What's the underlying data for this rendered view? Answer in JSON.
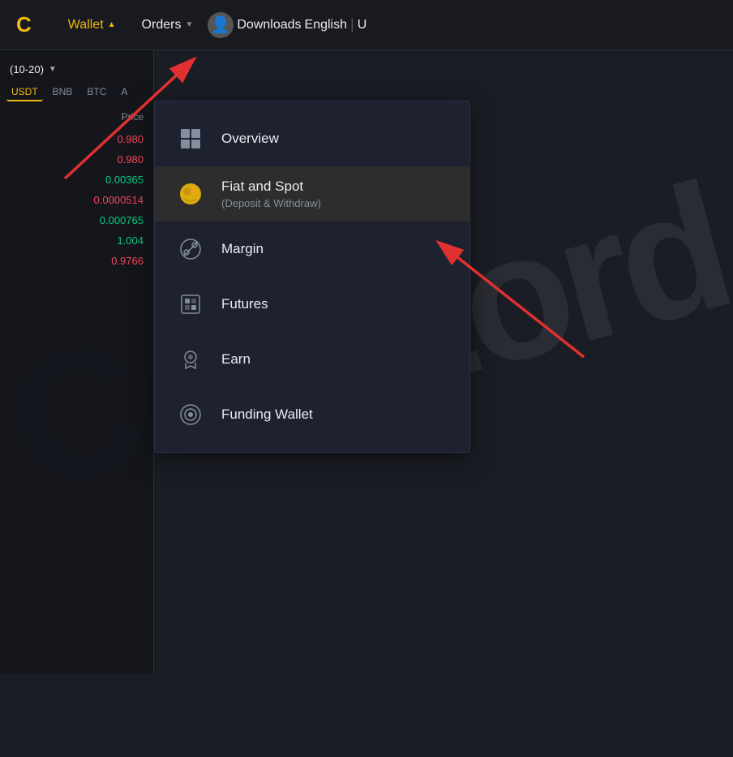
{
  "navbar": {
    "logo": "C",
    "wallet_label": "Wallet",
    "orders_label": "Orders",
    "downloads_label": "Downloads",
    "english_label": "English",
    "u_label": "U"
  },
  "sidebar": {
    "filter_label": "(10-20)",
    "coin_tabs": [
      "USDT",
      "BNB",
      "BTC",
      "A"
    ],
    "price_header": "Price",
    "prices": [
      {
        "value": "0.980",
        "color": "red"
      },
      {
        "value": "0.980",
        "color": "red"
      },
      {
        "value": "0.00365",
        "color": "green"
      },
      {
        "value": "0.0000514",
        "color": "red"
      },
      {
        "value": "0.000765",
        "color": "green"
      },
      {
        "value": "1.004",
        "color": "green"
      },
      {
        "value": "0.9766",
        "color": "red"
      }
    ]
  },
  "dropdown": {
    "items": [
      {
        "id": "overview",
        "icon": "⊞",
        "title": "Overview",
        "subtitle": "",
        "highlighted": false
      },
      {
        "id": "fiat-spot",
        "icon": "🪙",
        "title": "Fiat and Spot",
        "subtitle": "(Deposit & Withdraw)",
        "highlighted": true
      },
      {
        "id": "margin",
        "icon": "✂",
        "title": "Margin",
        "subtitle": "",
        "highlighted": false
      },
      {
        "id": "futures",
        "icon": "▣",
        "title": "Futures",
        "subtitle": "",
        "highlighted": false
      },
      {
        "id": "earn",
        "icon": "🔒",
        "title": "Earn",
        "subtitle": "",
        "highlighted": false
      },
      {
        "id": "funding-wallet",
        "icon": "◎",
        "title": "Funding Wallet",
        "subtitle": "",
        "highlighted": false
      }
    ]
  },
  "watermark": "CoinLord"
}
